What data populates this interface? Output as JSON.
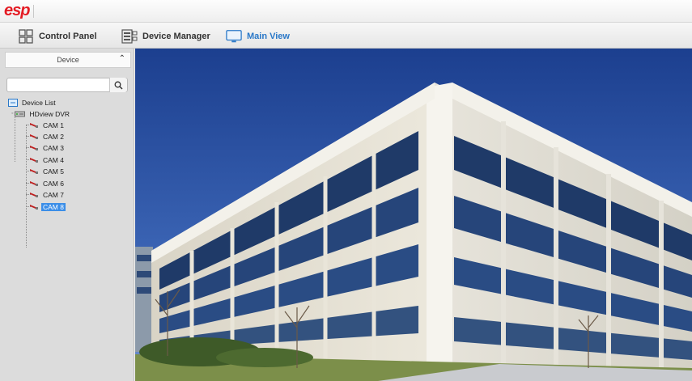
{
  "titlebar": {
    "logo": "esp"
  },
  "toolbar": {
    "items": [
      {
        "label": "Control Panel",
        "icon": "grid-icon"
      },
      {
        "label": "Device Manager",
        "icon": "device-manager-icon"
      },
      {
        "label": "Main View",
        "icon": "monitor-icon",
        "active": true
      }
    ]
  },
  "sidebar": {
    "header": "Device",
    "search": {
      "value": "",
      "placeholder": ""
    },
    "tree": {
      "root": "Device List",
      "dvr": "HDview DVR",
      "cameras": [
        "CAM 1",
        "CAM 2",
        "CAM 3",
        "CAM 4",
        "CAM 5",
        "CAM 6",
        "CAM 7",
        "CAM 8"
      ],
      "selected": "CAM 8"
    }
  },
  "colors": {
    "accent": "#2a78c8",
    "selection": "#3b8ee8",
    "logo": "#e41b23"
  }
}
